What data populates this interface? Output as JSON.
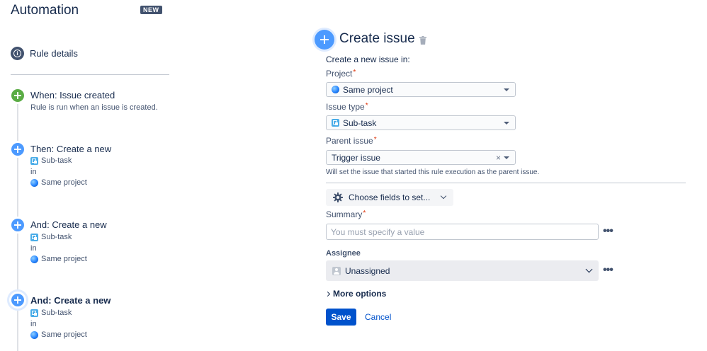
{
  "header": {
    "title": "Automation",
    "badge": "NEW"
  },
  "sidebar": {
    "rule_details": "Rule details",
    "steps": [
      {
        "title": "When: Issue created",
        "description": "Rule is run when an issue is created."
      },
      {
        "title": "Then: Create a new",
        "issue_type": "Sub-task",
        "connector": "in",
        "project": "Same project"
      },
      {
        "title": "And: Create a new",
        "issue_type": "Sub-task",
        "connector": "in",
        "project": "Same project"
      },
      {
        "title": "And: Create a new",
        "issue_type": "Sub-task",
        "connector": "in",
        "project": "Same project"
      }
    ]
  },
  "panel": {
    "title": "Create issue",
    "section_label": "Create a new issue in:",
    "project": {
      "label": "Project",
      "required_mark": "*",
      "value": "Same project"
    },
    "issue_type": {
      "label": "Issue type",
      "required_mark": "*",
      "value": "Sub-task"
    },
    "parent_issue": {
      "label": "Parent issue",
      "required_mark": "*",
      "value": "Trigger issue",
      "clear": "×",
      "helper": "Will set the issue that started this rule execution as the parent issue."
    },
    "choose_fields": "Choose fields to set...",
    "summary": {
      "label": "Summary",
      "required_mark": "*",
      "value": "",
      "placeholder": "You must specify a value",
      "more": "•••"
    },
    "assignee": {
      "label": "Assignee",
      "value": "Unassigned",
      "more": "•••"
    },
    "more_options": "More options",
    "save": "Save",
    "cancel": "Cancel"
  },
  "colors": {
    "primary": "#0052cc",
    "step_blue": "#4c9aff",
    "step_green": "#5aac44",
    "text": "#172b4d"
  }
}
